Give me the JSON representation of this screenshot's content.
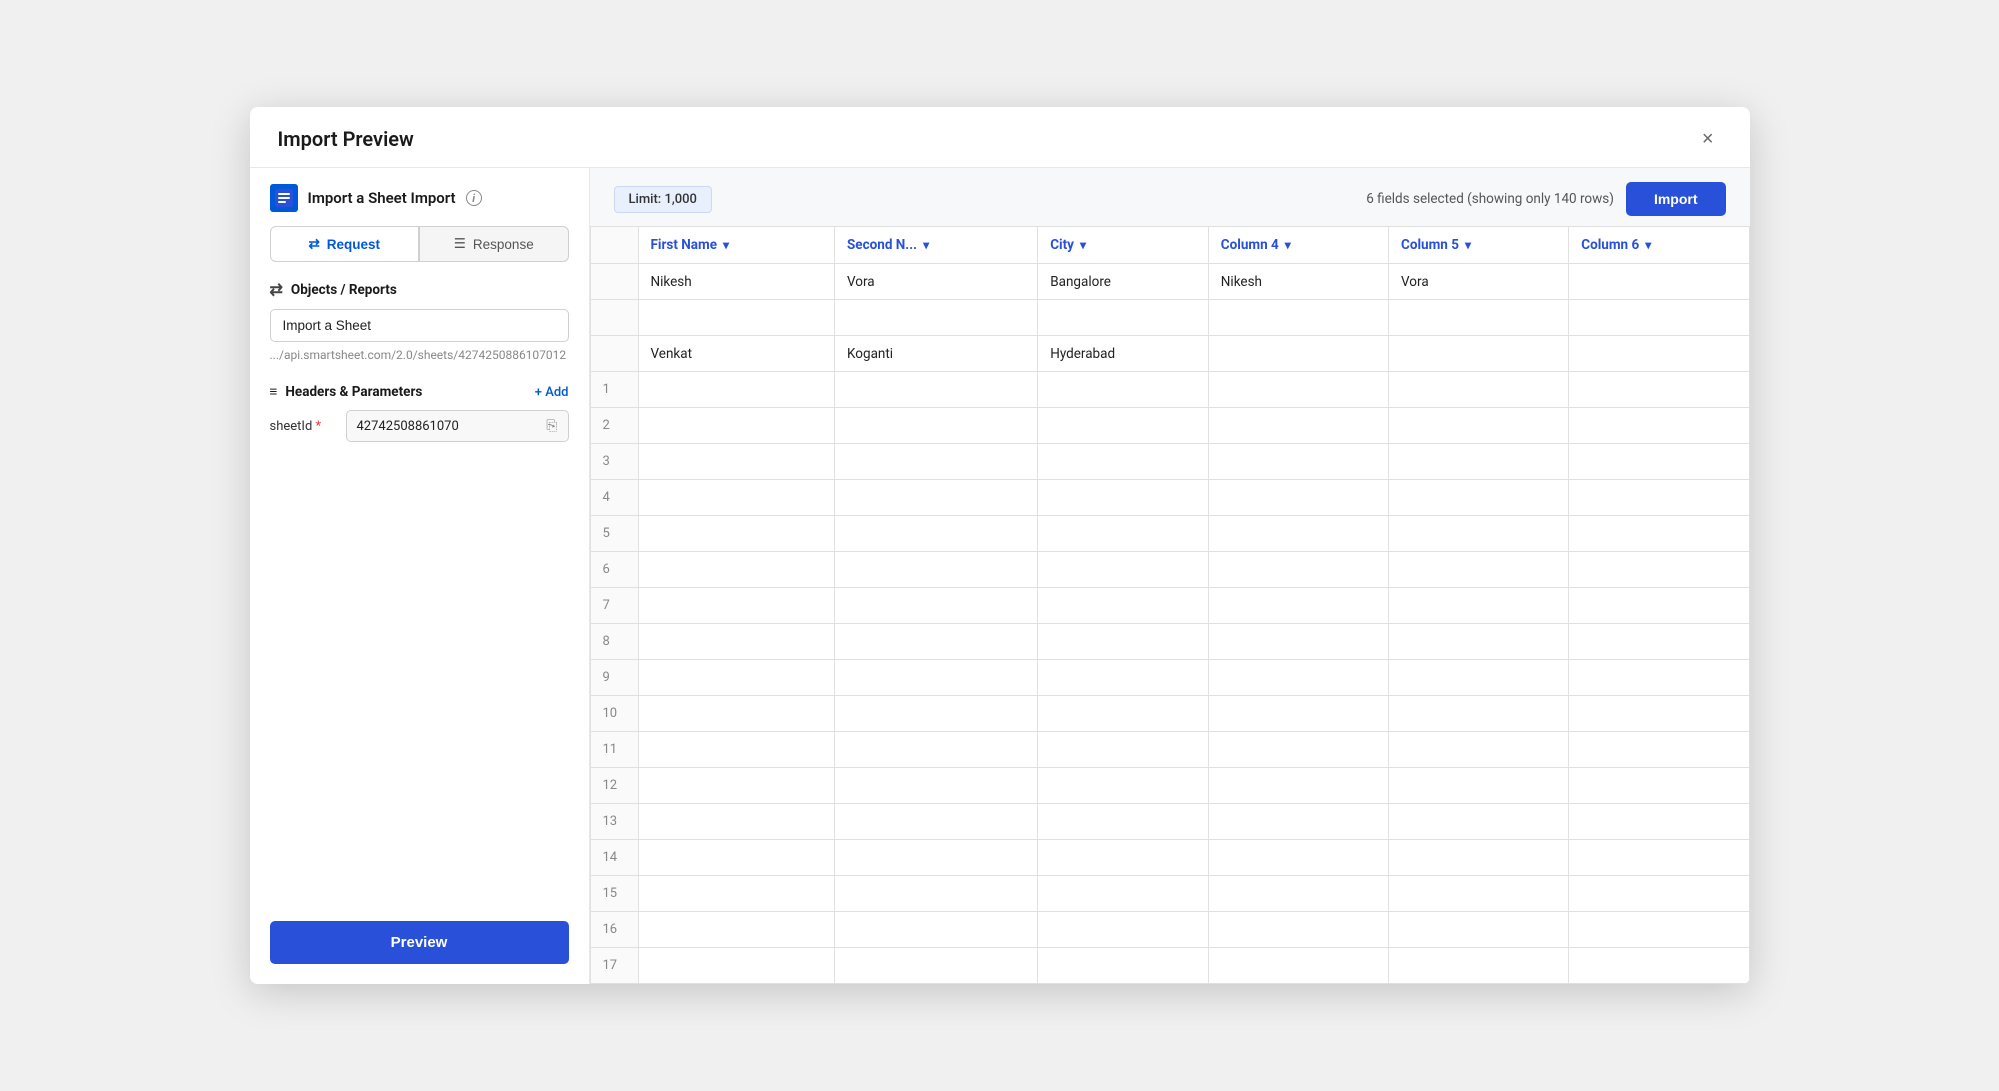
{
  "modal": {
    "title": "Import Preview",
    "close_label": "×"
  },
  "header": {
    "sheet_name": "Import a Sheet Import",
    "info_icon": "i"
  },
  "tabs": [
    {
      "id": "request",
      "label": "Request",
      "active": true
    },
    {
      "id": "response",
      "label": "Response",
      "active": false
    }
  ],
  "sections": {
    "objects_reports": "Objects / Reports",
    "headers_parameters": "Headers & Parameters"
  },
  "objects": {
    "input_value": "Import a Sheet",
    "api_url": ".../api.smartsheet.com/2.0/sheets/4274250886107012"
  },
  "params": {
    "sheetId_label": "sheetId",
    "sheetId_required": true,
    "sheetId_value": "42742508861070",
    "add_label": "+ Add"
  },
  "limit_badge": "Limit: 1,000",
  "fields_info": "6 fields selected (showing only 140 rows)",
  "import_btn_label": "Import",
  "preview_btn_label": "Preview",
  "table": {
    "columns": [
      {
        "id": "first_name",
        "label": "First Name",
        "has_dropdown": true
      },
      {
        "id": "second_n",
        "label": "Second N...",
        "has_dropdown": true
      },
      {
        "id": "city",
        "label": "City",
        "has_dropdown": true
      },
      {
        "id": "column4",
        "label": "Column 4",
        "has_dropdown": true
      },
      {
        "id": "column5",
        "label": "Column 5",
        "has_dropdown": true
      },
      {
        "id": "column6",
        "label": "Column 6",
        "has_dropdown": true
      }
    ],
    "rows": [
      {
        "num": "",
        "first_name": "Nikesh",
        "second_n": "Vora",
        "city": "Bangalore",
        "column4": "Nikesh",
        "column5": "Vora",
        "column6": ""
      },
      {
        "num": "",
        "first_name": "",
        "second_n": "",
        "city": "",
        "column4": "",
        "column5": "",
        "column6": ""
      },
      {
        "num": "",
        "first_name": "Venkat",
        "second_n": "Koganti",
        "city": "Hyderabad",
        "column4": "",
        "column5": "",
        "column6": ""
      },
      {
        "num": "1",
        "first_name": "",
        "second_n": "",
        "city": "",
        "column4": "",
        "column5": "",
        "column6": ""
      },
      {
        "num": "2",
        "first_name": "",
        "second_n": "",
        "city": "",
        "column4": "",
        "column5": "",
        "column6": ""
      },
      {
        "num": "3",
        "first_name": "",
        "second_n": "",
        "city": "",
        "column4": "",
        "column5": "",
        "column6": ""
      },
      {
        "num": "4",
        "first_name": "",
        "second_n": "",
        "city": "",
        "column4": "",
        "column5": "",
        "column6": ""
      },
      {
        "num": "5",
        "first_name": "",
        "second_n": "",
        "city": "",
        "column4": "",
        "column5": "",
        "column6": ""
      },
      {
        "num": "6",
        "first_name": "",
        "second_n": "",
        "city": "",
        "column4": "",
        "column5": "",
        "column6": ""
      },
      {
        "num": "7",
        "first_name": "",
        "second_n": "",
        "city": "",
        "column4": "",
        "column5": "",
        "column6": ""
      },
      {
        "num": "8",
        "first_name": "",
        "second_n": "",
        "city": "",
        "column4": "",
        "column5": "",
        "column6": ""
      },
      {
        "num": "9",
        "first_name": "",
        "second_n": "",
        "city": "",
        "column4": "",
        "column5": "",
        "column6": ""
      },
      {
        "num": "10",
        "first_name": "",
        "second_n": "",
        "city": "",
        "column4": "",
        "column5": "",
        "column6": ""
      },
      {
        "num": "11",
        "first_name": "",
        "second_n": "",
        "city": "",
        "column4": "",
        "column5": "",
        "column6": ""
      },
      {
        "num": "12",
        "first_name": "",
        "second_n": "",
        "city": "",
        "column4": "",
        "column5": "",
        "column6": ""
      },
      {
        "num": "13",
        "first_name": "",
        "second_n": "",
        "city": "",
        "column4": "",
        "column5": "",
        "column6": ""
      },
      {
        "num": "14",
        "first_name": "",
        "second_n": "",
        "city": "",
        "column4": "",
        "column5": "",
        "column6": ""
      },
      {
        "num": "15",
        "first_name": "",
        "second_n": "",
        "city": "",
        "column4": "",
        "column5": "",
        "column6": ""
      },
      {
        "num": "16",
        "first_name": "",
        "second_n": "",
        "city": "",
        "column4": "",
        "column5": "",
        "column6": ""
      },
      {
        "num": "17",
        "first_name": "",
        "second_n": "",
        "city": "",
        "column4": "",
        "column5": "",
        "column6": ""
      }
    ]
  },
  "icons": {
    "request_icon": "⇄",
    "response_icon": "☰",
    "objects_icon": "⇄",
    "headers_icon": "≡",
    "copy_icon": "⎘"
  },
  "colors": {
    "primary": "#2850d9",
    "accent_light": "#e8f0fe"
  }
}
